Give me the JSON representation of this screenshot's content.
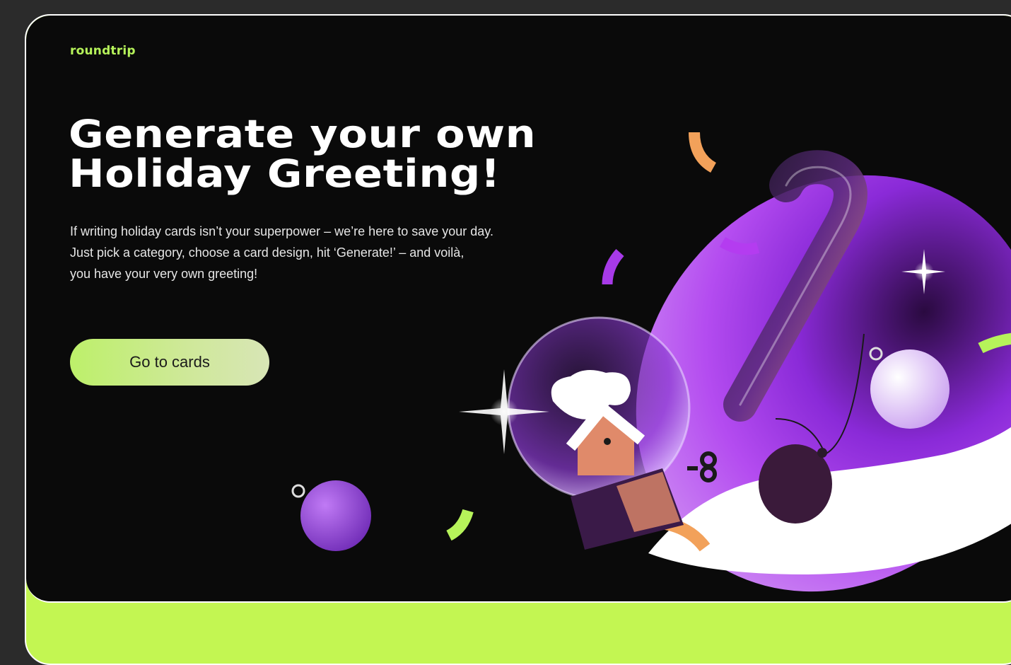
{
  "brand": {
    "logo_text": "roundtrip"
  },
  "hero": {
    "title_line1": "Generate your own",
    "title_line2": "Holiday Greeting!",
    "description_line1": "If writing holiday cards isn’t your superpower – we’re here to save your day.",
    "description_line2": "Just pick a category, choose a card design, hit ‘Generate!’ – and voilà,",
    "description_line3": "you have your very own greeting!",
    "cta_label": "Go to cards"
  },
  "colors": {
    "accent_green": "#c3f652",
    "purple": "#a530f0",
    "background": "#0a0a0a",
    "page_background": "#2b2b2b"
  }
}
